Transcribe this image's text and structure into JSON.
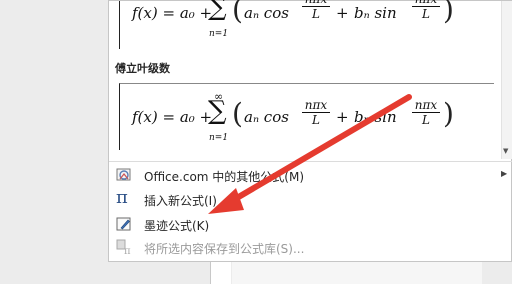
{
  "section_title": "傅立叶级数",
  "formula": {
    "lhs": "f(x) = a₀ +",
    "sum_symbol": "∑",
    "sum_upper": "∞",
    "sum_lower": "n=1",
    "open_paren": "(",
    "a_term": "aₙ cos",
    "frac_num": "nπx",
    "frac_den": "L",
    "plus": "+",
    "b_term": "bₙ sin",
    "close_paren": ")"
  },
  "menu": {
    "office": "Office.com 中的其他公式(M)",
    "insert": "插入新公式(I)",
    "ink": "墨迹公式(K)",
    "save": "将所选内容保存到公式库(S)..."
  },
  "icons": {
    "office": "office-gallery-icon",
    "insert": "pi-icon",
    "ink": "ink-pen-icon",
    "save": "save-formula-icon",
    "submenu": "chevron-right-icon",
    "scroll_down": "scroll-down-arrow-icon"
  },
  "colors": {
    "annotation_arrow": "#e53b2f",
    "menu_text": "#262626",
    "disabled_text": "#9a9a9a"
  },
  "glyphs": {
    "submenu_arrow": "▶",
    "scroll_down": "▼",
    "pi": "π"
  }
}
